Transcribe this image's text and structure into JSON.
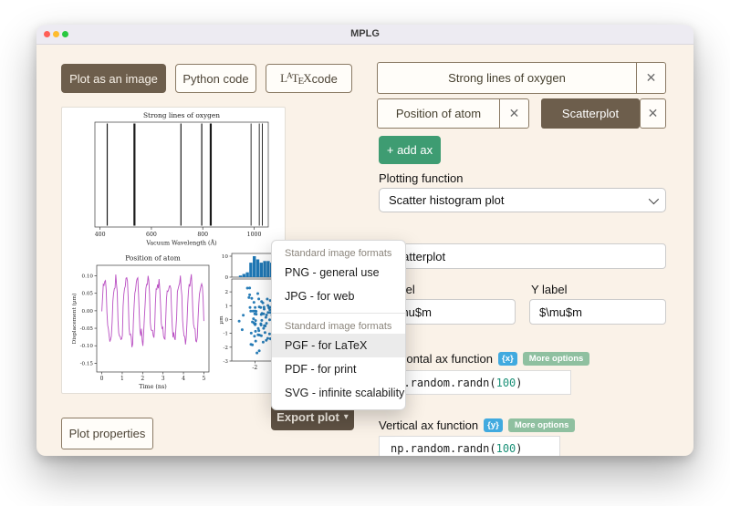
{
  "window": {
    "title": "MPLG"
  },
  "toolbar": {
    "plot_image": "Plot as an image",
    "python_code": "Python code",
    "latex": {
      "p1": "L",
      "p2": "A",
      "p3": "T",
      "p4": "E",
      "p5": "X",
      "suffix": " code"
    }
  },
  "icons": {
    "close": "✕",
    "caret_down": "▾"
  },
  "tabs": [
    {
      "label": "Strong lines of oxygen",
      "active": false
    },
    {
      "label": "Position of atom",
      "active": false
    },
    {
      "label": "Scatterplot",
      "active": true
    }
  ],
  "add_ax_label": "+ add ax",
  "plotting_function": {
    "label": "Plotting function",
    "value": "Scatter histogram plot"
  },
  "fields": {
    "title_value": "Scatterplot",
    "x_label": {
      "label": "X label",
      "value": "$\\mu$m"
    },
    "y_label": {
      "label": "Y label",
      "value": "$\\mu$m"
    }
  },
  "ax_functions": {
    "horizontal": {
      "label": "Horizontal ax function",
      "badge": "{x}",
      "more": "More options",
      "code_pre": "np.random.randn(",
      "code_num": "100",
      "code_post": ")"
    },
    "vertical": {
      "label": "Vertical ax function",
      "badge": "{y}",
      "more": "More options",
      "code_pre": "np.random.randn(",
      "code_num": "100",
      "code_post": ")"
    }
  },
  "export": {
    "label": "Export plot"
  },
  "plot_properties_label": "Plot properties",
  "menu": {
    "sections": [
      {
        "header": "Standard image formats",
        "items": [
          {
            "label": "PNG - general use"
          },
          {
            "label": "JPG - for web"
          }
        ]
      },
      {
        "header": "Standard image formats",
        "items": [
          {
            "label": "PGF - for LaTeX",
            "highlighted": true
          },
          {
            "label": "PDF - for print"
          },
          {
            "label": "SVG - infinite scalability"
          }
        ]
      }
    ]
  },
  "colors": {
    "accent_brown": "#6d5e4c",
    "export_brown": "#5f5244",
    "add_ax_green": "#3e9c72",
    "badge_blue": "#41aadf",
    "badge_green": "#8fc0a0",
    "code_number": "#1c9178",
    "window_bg": "#faf2e8",
    "titlebar_bg": "#edebf2"
  },
  "chart_data": [
    {
      "type": "vlines",
      "title": "Strong lines of oxygen",
      "xlabel": "Vacuum Wavelength (Å)",
      "xticks": [
        400,
        600,
        800,
        1000
      ],
      "xlim": [
        380,
        1055
      ],
      "lines": [
        {
          "x": 428,
          "lw": 1.2
        },
        {
          "x": 534,
          "lw": 2.2
        },
        {
          "x": 715,
          "lw": 1.2
        },
        {
          "x": 796,
          "lw": 1.2
        },
        {
          "x": 831,
          "lw": 2.2
        },
        {
          "x": 988,
          "lw": 0.9
        },
        {
          "x": 1020,
          "lw": 0.9
        },
        {
          "x": 1032,
          "lw": 0.9
        }
      ],
      "color": "#1a1a1a"
    },
    {
      "type": "line",
      "title": "Position of atom",
      "xlabel": "Time (ns)",
      "ylabel": "Displacement (µm)",
      "xticks": [
        0,
        1,
        2,
        3,
        4,
        5
      ],
      "ytick_labels": [
        "0.10",
        "0.05",
        "0.00",
        "-0.05",
        "-0.10",
        "-0.15"
      ],
      "ytick_values": [
        0.1,
        0.05,
        0.0,
        -0.05,
        -0.1,
        -0.15
      ],
      "xlim": [
        -0.25,
        5.25
      ],
      "ylim": [
        -0.175,
        0.13
      ],
      "color": "#b94fc2",
      "signal": {
        "amplitude": 0.088,
        "frequency_cycles_per_ns": 1.9,
        "harmonic_amplitude": 0.018,
        "harmonic_frequency": 5.7,
        "noise": 0.032,
        "n_points": 140,
        "seed": 7
      }
    },
    {
      "type": "scatter_hist",
      "hist": {
        "ytick_labels": [
          "10",
          "0"
        ],
        "ytick_values": [
          10,
          0
        ],
        "bin_width": 0.3,
        "color": "#1f77b4"
      },
      "scatter": {
        "ylabel": "µm",
        "ytick_values": [
          2,
          1,
          0,
          -1,
          -2,
          -3
        ],
        "xtick_values": [
          -2
        ],
        "xlim": [
          -4,
          0.5
        ],
        "ylim": [
          -3.0,
          2.93
        ],
        "n_points": 90,
        "seed": 11,
        "mean_x": -1.35,
        "sd_x": 0.85,
        "mean_y": -0.1,
        "sd_y": 1.05,
        "color": "#1f77b4"
      }
    }
  ]
}
